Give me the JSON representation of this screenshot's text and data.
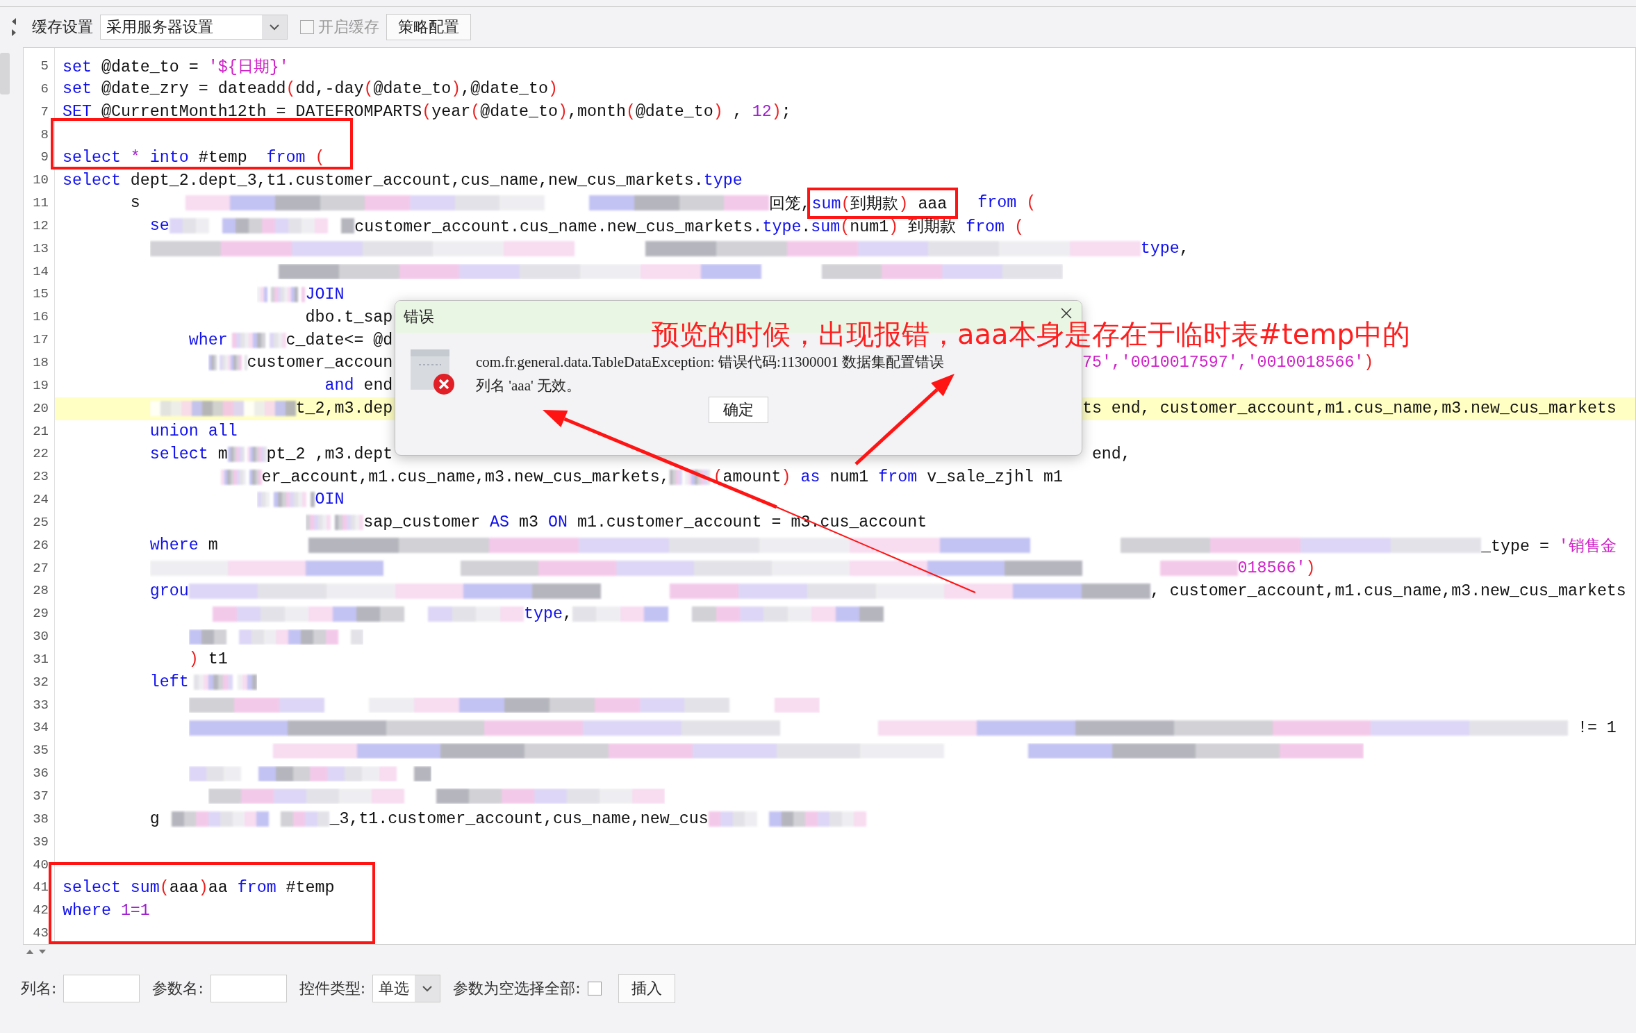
{
  "toolbar": {
    "label": "缓存设置",
    "select_value": "采用服务器设置",
    "checkbox": {
      "label": "开启缓存",
      "checked": false,
      "disabled": true
    },
    "button": "策略配置"
  },
  "code_lines": [
    {
      "no": "5",
      "highlighted": false,
      "segments": [
        {
          "kind": "kw",
          "text": "set"
        },
        {
          "kind": "plain",
          "text": " @date_to = "
        },
        {
          "kind": "str",
          "text": "'${日期}'"
        }
      ]
    },
    {
      "no": "6",
      "highlighted": false,
      "segments": [
        {
          "kind": "kw",
          "text": "set"
        },
        {
          "kind": "plain",
          "text": " @date_zry = dateadd"
        },
        {
          "kind": "paren",
          "text": "("
        },
        {
          "kind": "plain",
          "text": "dd,-day"
        },
        {
          "kind": "paren",
          "text": "("
        },
        {
          "kind": "plain",
          "text": "@date_to"
        },
        {
          "kind": "paren",
          "text": ")"
        },
        {
          "kind": "plain",
          "text": ",@date_to"
        },
        {
          "kind": "paren",
          "text": ")"
        }
      ]
    },
    {
      "no": "7",
      "highlighted": false,
      "segments": [
        {
          "kind": "kw",
          "text": "SET"
        },
        {
          "kind": "plain",
          "text": " @CurrentMonth12th = DATEFROMPARTS"
        },
        {
          "kind": "paren",
          "text": "("
        },
        {
          "kind": "plain",
          "text": "year"
        },
        {
          "kind": "paren",
          "text": "("
        },
        {
          "kind": "plain",
          "text": "@date_to"
        },
        {
          "kind": "paren",
          "text": ")"
        },
        {
          "kind": "plain",
          "text": ",month"
        },
        {
          "kind": "paren",
          "text": "("
        },
        {
          "kind": "plain",
          "text": "@date_to"
        },
        {
          "kind": "paren",
          "text": ")"
        },
        {
          "kind": "plain",
          "text": " , "
        },
        {
          "kind": "num",
          "text": "12"
        },
        {
          "kind": "paren",
          "text": ")"
        },
        {
          "kind": "plain",
          "text": ";"
        }
      ]
    },
    {
      "no": "8",
      "highlighted": false
    },
    {
      "no": "9",
      "highlighted": false,
      "segments": [
        {
          "kind": "kw",
          "text": "select"
        },
        {
          "kind": "num",
          "text": " *"
        },
        {
          "kind": "kw",
          "text": " into"
        },
        {
          "kind": "plain",
          "text": " #temp  "
        },
        {
          "kind": "kw",
          "text": "from"
        },
        {
          "kind": "paren",
          "text": " ("
        }
      ]
    },
    {
      "no": "10",
      "highlighted": false,
      "segments": [
        {
          "kind": "kw",
          "text": "select"
        },
        {
          "kind": "plain",
          "text": " dept_2.dept_3,t1.customer_account,cus_name,new_cus_markets."
        },
        {
          "kind": "kw",
          "text": "type"
        }
      ]
    },
    {
      "no": "11",
      "highlighted": false,
      "segments": [
        {
          "kind": "plain",
          "text": "s"
        },
        {
          "kind": "blur"
        },
        {
          "kind": "plain",
          "text": "回笼,"
        }
      ],
      "framed": [
        {
          "kind": "kw",
          "text": "sum"
        },
        {
          "kind": "paren",
          "text": "("
        },
        {
          "kind": "plain",
          "text": "到期款"
        },
        {
          "kind": "paren",
          "text": ")"
        },
        {
          "kind": "plain",
          "text": " aaa"
        }
      ],
      "after": [
        {
          "kind": "kw",
          "text": "  from"
        },
        {
          "kind": "paren",
          "text": " ("
        }
      ]
    },
    {
      "no": "12",
      "highlighted": false,
      "segments": [
        {
          "kind": "kw",
          "text": "se"
        },
        {
          "kind": "blur"
        },
        {
          "kind": "plain",
          "text": "customer_account.cus_name.new_cus_markets."
        },
        {
          "kind": "kw",
          "text": "type"
        },
        {
          "kind": "plain",
          "text": "."
        },
        {
          "kind": "kw",
          "text": "sum"
        },
        {
          "kind": "paren",
          "text": "("
        },
        {
          "kind": "plain",
          "text": "num1"
        },
        {
          "kind": "paren",
          "text": ")"
        },
        {
          "kind": "plain",
          "text": " 到期款 "
        },
        {
          "kind": "kw",
          "text": "from"
        },
        {
          "kind": "paren",
          "text": " ("
        }
      ]
    },
    {
      "no": "13",
      "highlighted": false,
      "segments": [
        {
          "kind": "blur"
        },
        {
          "kind": "kw",
          "text": "type"
        },
        {
          "kind": "plain",
          "text": ","
        }
      ]
    },
    {
      "no": "14",
      "highlighted": false,
      "segments": [
        {
          "kind": "blur"
        }
      ]
    },
    {
      "no": "15",
      "highlighted": false,
      "segments": [
        {
          "kind": "blur"
        },
        {
          "kind": "kw",
          "text": "JOIN"
        }
      ]
    },
    {
      "no": "16",
      "highlighted": false,
      "segments": [
        {
          "kind": "plain",
          "text": "dbo.t_sap"
        }
      ]
    },
    {
      "no": "17",
      "highlighted": false,
      "segments": [
        {
          "kind": "kw",
          "text": "wher"
        },
        {
          "kind": "blur"
        },
        {
          "kind": "plain",
          "text": "c_date<= @d"
        }
      ]
    },
    {
      "no": "18",
      "highlighted": false,
      "segments": [
        {
          "kind": "blur"
        },
        {
          "kind": "plain",
          "text": "customer_accoun"
        }
      ],
      "tail": [
        {
          "kind": "str",
          "text": "75','0010017597','0010018566'"
        },
        {
          "kind": "paren",
          "text": ")"
        }
      ]
    },
    {
      "no": "19",
      "highlighted": false,
      "segments": [
        {
          "kind": "kw",
          "text": "and"
        },
        {
          "kind": "plain",
          "text": " end"
        }
      ]
    },
    {
      "no": "20",
      "highlighted": true,
      "segments": [
        {
          "kind": "blur"
        },
        {
          "kind": "plain",
          "text": "t_2,m3.dep"
        }
      ],
      "tail": [
        {
          "kind": "plain",
          "text": "ts end, customer_account,m1.cus_name,m3.new_cus_markets"
        }
      ]
    },
    {
      "no": "21",
      "highlighted": false,
      "segments": [
        {
          "kind": "kw",
          "text": "union all"
        }
      ]
    },
    {
      "no": "22",
      "highlighted": false,
      "segments": [
        {
          "kind": "kw",
          "text": "select"
        },
        {
          "kind": "plain",
          "text": " m"
        },
        {
          "kind": "blur"
        },
        {
          "kind": "plain",
          "text": "pt_2 ,m3.dept"
        }
      ],
      "tail": [
        {
          "kind": "plain",
          "text": "end,"
        }
      ]
    },
    {
      "no": "23",
      "highlighted": false,
      "segments": [
        {
          "kind": "blur"
        },
        {
          "kind": "plain",
          "text": "er_account,m1.cus_name,m3.new_cus_markets,"
        },
        {
          "kind": "blur"
        },
        {
          "kind": "paren",
          "text": "("
        },
        {
          "kind": "plain",
          "text": "amount"
        },
        {
          "kind": "paren",
          "text": ")"
        },
        {
          "kind": "kw",
          "text": " as"
        },
        {
          "kind": "plain",
          "text": " num1 "
        },
        {
          "kind": "kw",
          "text": "from"
        },
        {
          "kind": "plain",
          "text": " v_sale_zjhl m1"
        }
      ]
    },
    {
      "no": "24",
      "highlighted": false,
      "segments": [
        {
          "kind": "blur"
        },
        {
          "kind": "kw",
          "text": "OIN"
        }
      ]
    },
    {
      "no": "25",
      "highlighted": false,
      "segments": [
        {
          "kind": "blur"
        },
        {
          "kind": "plain",
          "text": "sap_customer "
        },
        {
          "kind": "kw",
          "text": "AS"
        },
        {
          "kind": "plain",
          "text": " m3 "
        },
        {
          "kind": "kw",
          "text": "ON"
        },
        {
          "kind": "plain",
          "text": " m1.customer_account = m3.cus_account"
        }
      ]
    },
    {
      "no": "26",
      "highlighted": false,
      "segments": [
        {
          "kind": "kw",
          "text": "where"
        },
        {
          "kind": "plain",
          "text": " m"
        },
        {
          "kind": "blur"
        },
        {
          "kind": "plain",
          "text": "_type = "
        },
        {
          "kind": "str",
          "text": "'销售金"
        }
      ]
    },
    {
      "no": "27",
      "highlighted": false,
      "segments": [
        {
          "kind": "blur"
        },
        {
          "kind": "str",
          "text": "018566'"
        },
        {
          "kind": "paren",
          "text": ")"
        }
      ]
    },
    {
      "no": "28",
      "highlighted": false,
      "segments": [
        {
          "kind": "kw",
          "text": "grou"
        },
        {
          "kind": "blur"
        },
        {
          "kind": "plain",
          "text": ", customer_account,m1.cus_name,m3.new_cus_markets"
        }
      ]
    },
    {
      "no": "29",
      "highlighted": false,
      "segments": [
        {
          "kind": "blur"
        },
        {
          "kind": "kw",
          "text": "type"
        },
        {
          "kind": "plain",
          "text": ","
        },
        {
          "kind": "blur"
        }
      ]
    },
    {
      "no": "30",
      "highlighted": false,
      "segments": [
        {
          "kind": "blur"
        }
      ]
    },
    {
      "no": "31",
      "highlighted": false,
      "segments": [
        {
          "kind": "paren",
          "text": ")"
        },
        {
          "kind": "plain",
          "text": " t1"
        }
      ]
    },
    {
      "no": "32",
      "highlighted": false,
      "segments": [
        {
          "kind": "kw",
          "text": "left"
        },
        {
          "kind": "blur"
        }
      ]
    },
    {
      "no": "33",
      "highlighted": false,
      "segments": [
        {
          "kind": "blur"
        }
      ]
    },
    {
      "no": "34",
      "highlighted": false,
      "segments": [
        {
          "kind": "blur"
        },
        {
          "kind": "plain",
          "text": " != 1"
        }
      ]
    },
    {
      "no": "35",
      "highlighted": false,
      "segments": [
        {
          "kind": "blur"
        }
      ]
    },
    {
      "no": "36",
      "highlighted": false,
      "segments": [
        {
          "kind": "blur"
        }
      ]
    },
    {
      "no": "37",
      "highlighted": false,
      "segments": [
        {
          "kind": "blur"
        }
      ]
    },
    {
      "no": "38",
      "highlighted": false,
      "segments": [
        {
          "kind": "plain",
          "text": "g"
        },
        {
          "kind": "blur"
        },
        {
          "kind": "plain",
          "text": "_3,t1.customer_account,cus_name,new_cus"
        },
        {
          "kind": "blur"
        }
      ]
    },
    {
      "no": "39",
      "highlighted": false
    },
    {
      "no": "40",
      "highlighted": false
    },
    {
      "no": "41",
      "highlighted": false,
      "segments": [
        {
          "kind": "kw",
          "text": "select"
        },
        {
          "kind": "kw",
          "text": " sum"
        },
        {
          "kind": "paren",
          "text": "("
        },
        {
          "kind": "plain",
          "text": "aaa"
        },
        {
          "kind": "paren",
          "text": ")"
        },
        {
          "kind": "plain",
          "text": "aa "
        },
        {
          "kind": "kw",
          "text": "from"
        },
        {
          "kind": "plain",
          "text": " #temp"
        }
      ]
    },
    {
      "no": "42",
      "highlighted": false,
      "segments": [
        {
          "kind": "kw",
          "text": "where"
        },
        {
          "kind": "num",
          "text": " 1=1"
        }
      ]
    },
    {
      "no": "43",
      "highlighted": false
    }
  ],
  "bottom_form": {
    "fields": [
      {
        "kind": "input",
        "label": "列名:"
      },
      {
        "kind": "input",
        "label": "参数名:"
      },
      {
        "kind": "select",
        "label": "控件类型:",
        "value": "单选"
      },
      {
        "kind": "checkbox",
        "label": "参数为空选择全部:",
        "checked": false
      }
    ],
    "button": "插入"
  },
  "dialog": {
    "title": "错误",
    "message_lines": [
      "com.fr.general.data.TableDataException: 错误代码:11300001 数据集配置错误",
      "列名 'aaa' 无效。"
    ],
    "button": "确定"
  },
  "annotation": {
    "note": "预览的时候，出现报错，aaa本身是存在于临时表#temp中的",
    "marks": [
      {
        "kind": "frame"
      },
      {
        "kind": "frame"
      },
      {
        "kind": "arrow"
      },
      {
        "kind": "arrow"
      },
      {
        "kind": "line"
      }
    ]
  }
}
